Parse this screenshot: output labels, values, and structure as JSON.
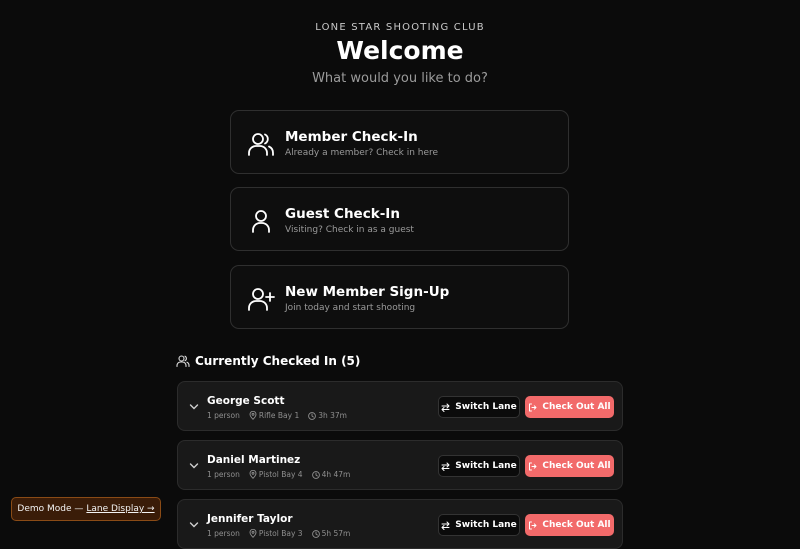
{
  "header": {
    "club_name": "LONE STAR SHOOTING CLUB",
    "title": "Welcome",
    "prompt": "What would you like to do?"
  },
  "options": [
    {
      "title": "Member Check-In",
      "subtitle": "Already a member? Check in here",
      "icon": "users-icon"
    },
    {
      "title": "Guest Check-In",
      "subtitle": "Visiting? Check in as a guest",
      "icon": "user-icon"
    },
    {
      "title": "New Member Sign-Up",
      "subtitle": "Join today and start shooting",
      "icon": "user-plus-icon"
    }
  ],
  "checked_in": {
    "label": "Currently Checked In (5)",
    "icon": "users-icon",
    "rows": [
      {
        "name": "George Scott",
        "party": "1 person",
        "lane": "Rifle Bay 1",
        "duration": "3h 37m"
      },
      {
        "name": "Daniel Martinez",
        "party": "1 person",
        "lane": "Pistol Bay 4",
        "duration": "4h 47m"
      },
      {
        "name": "Jennifer Taylor",
        "party": "1 person",
        "lane": "Pistol Bay 3",
        "duration": "5h 57m"
      }
    ],
    "switch_label": "Switch Lane",
    "checkout_label": "Check Out All"
  },
  "demo": {
    "text": "Demo Mode —",
    "link": "Lane Display →"
  },
  "colors": {
    "background": "#0b0b0b",
    "accent_red": "#f26a6a",
    "demo_bg": "#3a1c08"
  }
}
